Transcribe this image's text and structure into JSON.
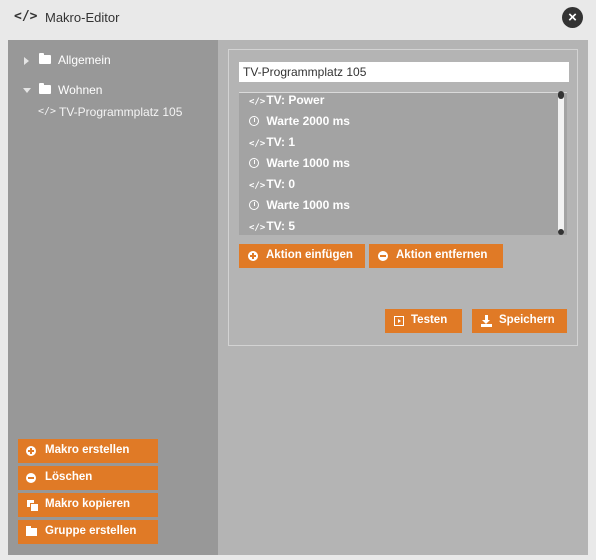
{
  "window": {
    "title_icon": "</>",
    "title": "Makro-Editor",
    "close_icon": "×"
  },
  "sidebar": {
    "tree": [
      {
        "label": "Allgemein",
        "expanded": false
      },
      {
        "label": "Wohnen",
        "expanded": true
      },
      {
        "label": "TV-Programmplatz 105",
        "is_macro": true,
        "selected": true
      }
    ],
    "buttons": {
      "create_macro": "Makro erstellen",
      "delete": "Löschen",
      "copy_macro": "Makro kopieren",
      "create_group": "Gruppe erstellen"
    }
  },
  "editor": {
    "macro_name_value": "TV-Programmplatz 105",
    "actions": [
      {
        "type": "code",
        "label": "TV: Power"
      },
      {
        "type": "wait",
        "label": "Warte 2000 ms"
      },
      {
        "type": "code",
        "label": "TV: 1"
      },
      {
        "type": "wait",
        "label": "Warte 1000 ms"
      },
      {
        "type": "code",
        "label": "TV: 0"
      },
      {
        "type": "wait",
        "label": "Warte 1000 ms"
      },
      {
        "type": "code",
        "label": "TV: 5"
      }
    ],
    "buttons": {
      "insert_action": "Aktion einfügen",
      "remove_action": "Aktion entfernen",
      "test": "Testen",
      "save": "Speichern"
    }
  },
  "colors": {
    "accent": "#e07a26",
    "sidebar_bg": "#989898",
    "content_bg": "#b4b4b4",
    "list_bg": "#a3a3a3",
    "titlebar_bg": "#e9e9e9"
  }
}
